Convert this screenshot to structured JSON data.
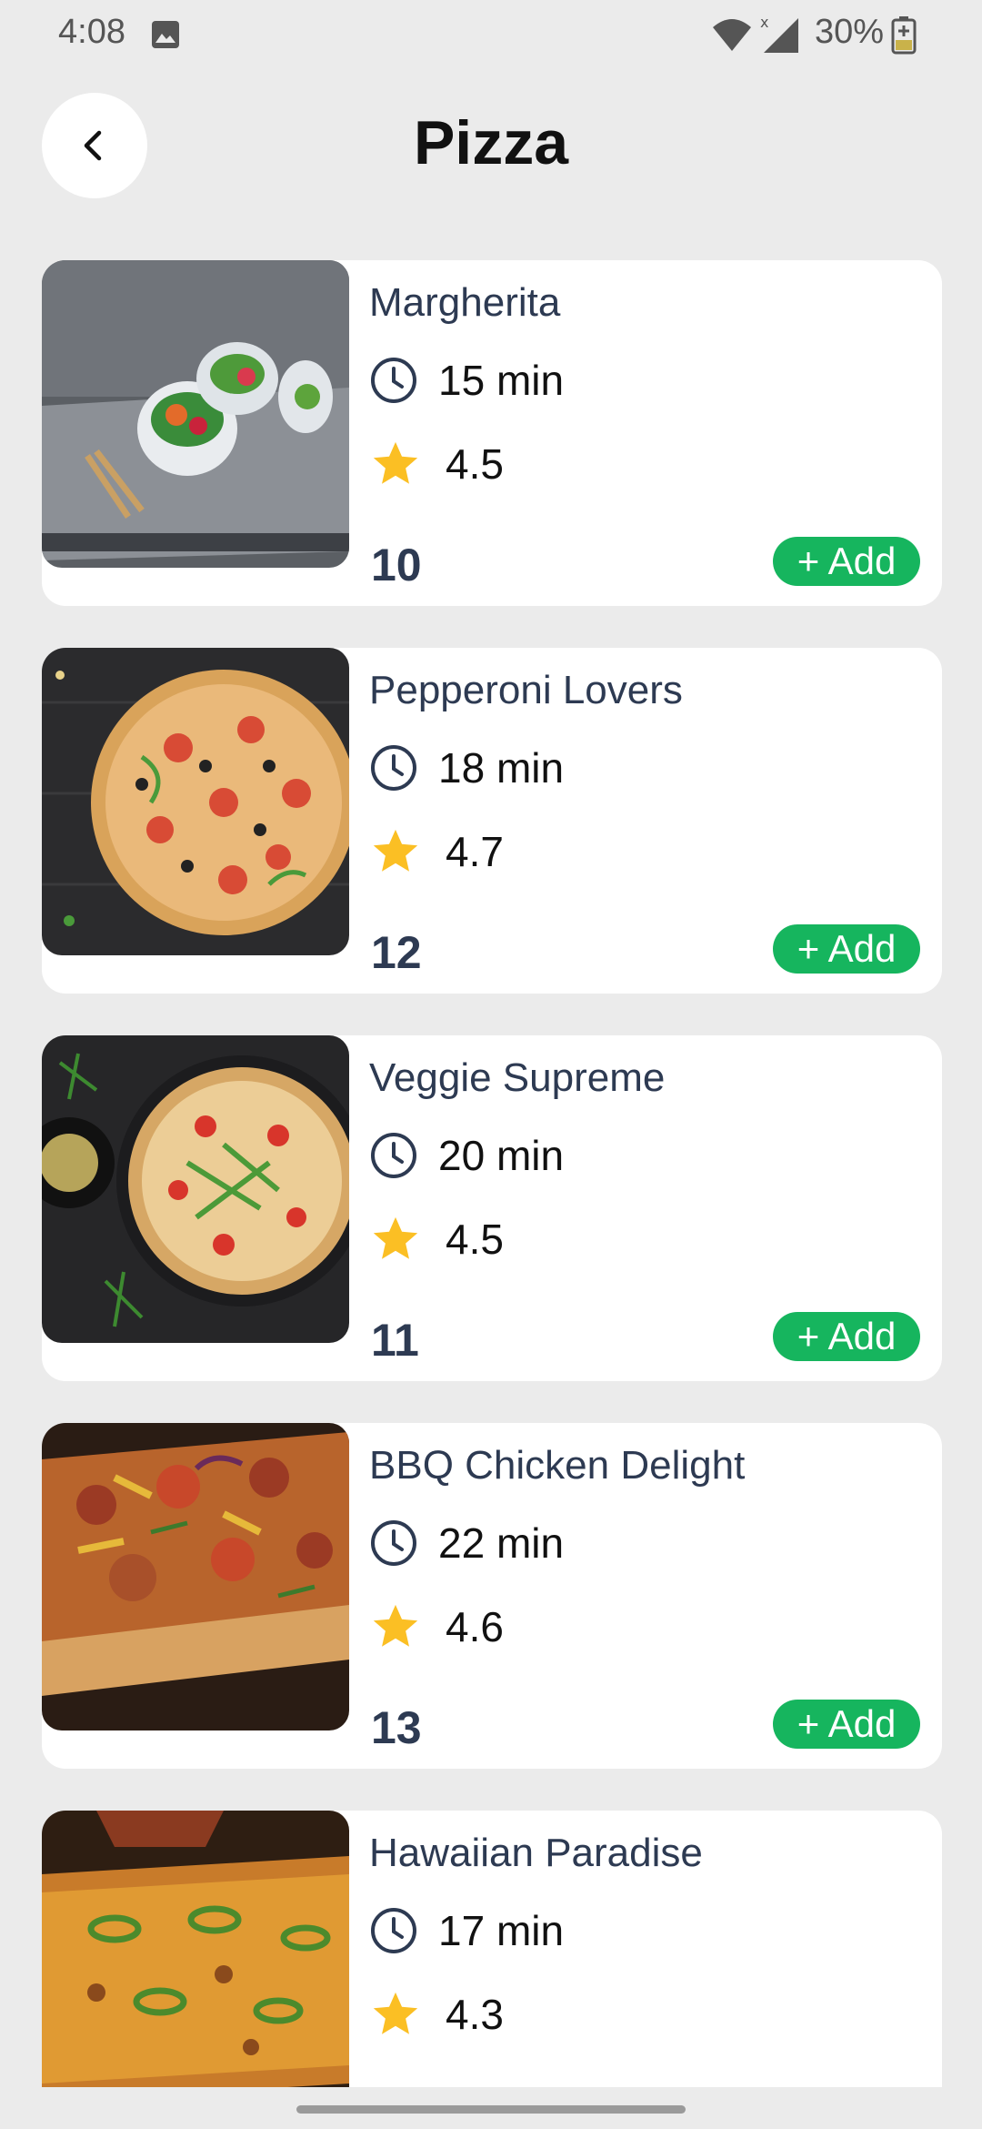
{
  "status_bar": {
    "time": "4:08",
    "battery": "30%",
    "icons": [
      "gallery-icon",
      "wifi-icon",
      "signal-icon",
      "battery-icon"
    ]
  },
  "header": {
    "title": "Pizza",
    "back_icon": "chevron-left-icon"
  },
  "colors": {
    "background": "#ebebeb",
    "card": "#ffffff",
    "title_text": "#2d3a52",
    "add_button": "#16b55e",
    "star": "#fbbf24"
  },
  "items": [
    {
      "name": "Margherita",
      "time": "15 min",
      "rating": "4.5",
      "price": "10",
      "add_label": "+ Add"
    },
    {
      "name": "Pepperoni Lovers",
      "time": "18 min",
      "rating": "4.7",
      "price": "12",
      "add_label": "+ Add"
    },
    {
      "name": "Veggie Supreme",
      "time": "20 min",
      "rating": "4.5",
      "price": "11",
      "add_label": "+ Add"
    },
    {
      "name": "BBQ Chicken Delight",
      "time": "22 min",
      "rating": "4.6",
      "price": "13",
      "add_label": "+ Add"
    },
    {
      "name": "Hawaiian Paradise",
      "time": "17 min",
      "rating": "4.3",
      "price": "",
      "add_label": ""
    }
  ]
}
